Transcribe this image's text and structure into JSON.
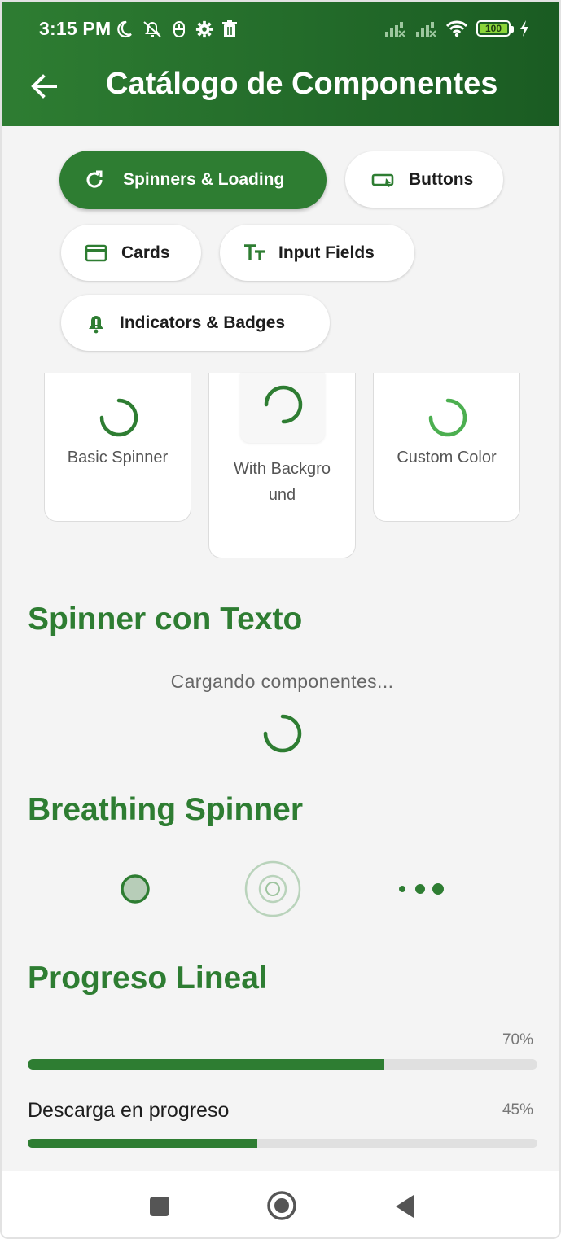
{
  "status_bar": {
    "time": "3:15 PM",
    "icons": [
      "moon-icon",
      "notifications-off-icon",
      "mouse-icon",
      "settings-icon",
      "trash-icon"
    ],
    "right_icons": [
      "signal-x-icon",
      "signal-x-icon",
      "wifi-icon",
      "battery-icon",
      "charging-icon"
    ],
    "battery_level": "100"
  },
  "app_bar": {
    "title": "Catálogo de Componentes",
    "back_icon": "arrow-left-icon"
  },
  "colors": {
    "primary": "#2e7d32",
    "primary_dark": "#1a5b22",
    "accent_light": "#4caf50",
    "background": "#f4f4f4"
  },
  "chips": [
    {
      "label": "Spinners & Loading",
      "icon": "refresh-icon",
      "active": true
    },
    {
      "label": "Buttons",
      "icon": "button-icon",
      "active": false
    },
    {
      "label": "Cards",
      "icon": "card-icon",
      "active": false
    },
    {
      "label": "Input Fields",
      "icon": "text-fields-icon",
      "active": false
    },
    {
      "label": "Indicators & Badges",
      "icon": "bell-alert-icon",
      "active": false
    }
  ],
  "spinner_cards": [
    {
      "label": "Basic Spinner"
    },
    {
      "label": "With Background"
    },
    {
      "label": "Custom Color"
    }
  ],
  "sections": {
    "spinner_text": {
      "title": "Spinner con Texto",
      "loading_text": "Cargando componentes..."
    },
    "breathing": {
      "title": "Breathing Spinner"
    },
    "linear": {
      "title": "Progreso Lineal",
      "bars": [
        {
          "label": "",
          "percent_label": "70%",
          "value": 0.7
        },
        {
          "label": "Descarga en progreso",
          "percent_label": "45%",
          "value": 0.45
        }
      ]
    }
  },
  "nav_bar": {
    "items": [
      "recents-square-icon",
      "home-circle-icon",
      "back-triangle-icon"
    ]
  }
}
